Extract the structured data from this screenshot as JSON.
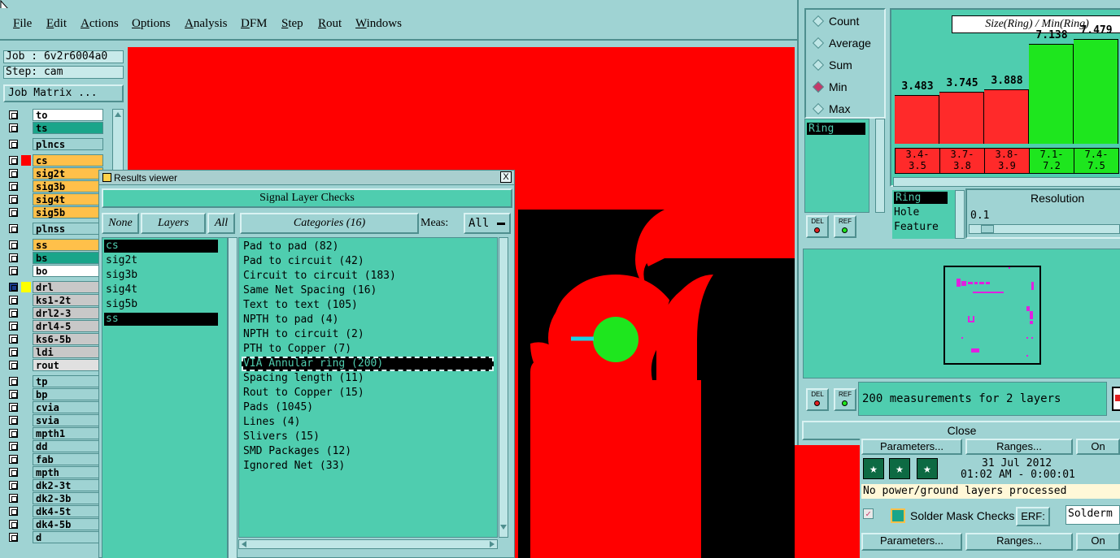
{
  "menu": [
    "File",
    "Edit",
    "Actions",
    "Options",
    "Analysis",
    "DFM",
    "Step",
    "Rout",
    "Windows"
  ],
  "job": {
    "job_label": "Job : 6v2r6004a0",
    "step_label": "Step: cam",
    "matrix_button": "Job Matrix ..."
  },
  "layers": [
    {
      "name": "to",
      "color": "#ffffff",
      "mark": ""
    },
    {
      "name": "ts",
      "color": "#1aa58a",
      "mark": ""
    },
    {
      "name": "plncs",
      "color": "#9fd3d3",
      "mark": ""
    },
    {
      "name": "cs",
      "color": "#ffc04a",
      "mark": "#ff0000"
    },
    {
      "name": "sig2t",
      "color": "#ffc04a",
      "mark": ""
    },
    {
      "name": "sig3b",
      "color": "#ffc04a",
      "mark": ""
    },
    {
      "name": "sig4t",
      "color": "#ffc04a",
      "mark": ""
    },
    {
      "name": "sig5b",
      "color": "#ffc04a",
      "mark": ""
    },
    {
      "name": "plnss",
      "color": "#9fd3d3",
      "mark": ""
    },
    {
      "name": "ss",
      "color": "#ffc04a",
      "mark": ""
    },
    {
      "name": "bs",
      "color": "#1aa58a",
      "mark": ""
    },
    {
      "name": "bo",
      "color": "#ffffff",
      "mark": ""
    },
    {
      "name": "drl",
      "color": "#c8c8c8",
      "mark": "#ffff00"
    },
    {
      "name": "ks1-2t",
      "color": "#c8c8c8",
      "mark": ""
    },
    {
      "name": "drl2-3",
      "color": "#c8c8c8",
      "mark": ""
    },
    {
      "name": "drl4-5",
      "color": "#c8c8c8",
      "mark": ""
    },
    {
      "name": "ks6-5b",
      "color": "#c8c8c8",
      "mark": ""
    },
    {
      "name": "ldi",
      "color": "#c8c8c8",
      "mark": ""
    },
    {
      "name": "rout",
      "color": "#e0e0e0",
      "mark": ""
    },
    {
      "name": "tp",
      "color": "#9fd3d3",
      "mark": ""
    },
    {
      "name": "bp",
      "color": "#9fd3d3",
      "mark": ""
    },
    {
      "name": "cvia",
      "color": "#9fd3d3",
      "mark": ""
    },
    {
      "name": "svia",
      "color": "#9fd3d3",
      "mark": ""
    },
    {
      "name": "mpth1",
      "color": "#9fd3d3",
      "mark": ""
    },
    {
      "name": "dd",
      "color": "#9fd3d3",
      "mark": ""
    },
    {
      "name": "fab",
      "color": "#9fd3d3",
      "mark": ""
    },
    {
      "name": "mpth",
      "color": "#9fd3d3",
      "mark": ""
    },
    {
      "name": "dk2-3t",
      "color": "#9fd3d3",
      "mark": ""
    },
    {
      "name": "dk2-3b",
      "color": "#9fd3d3",
      "mark": ""
    },
    {
      "name": "dk4-5t",
      "color": "#9fd3d3",
      "mark": ""
    },
    {
      "name": "dk4-5b",
      "color": "#9fd3d3",
      "mark": ""
    },
    {
      "name": "d",
      "color": "#9fd3d3",
      "mark": ""
    }
  ],
  "results_viewer": {
    "title": "Results viewer",
    "close": "X",
    "header": "Signal Layer Checks",
    "none_btn": "None",
    "layers_btn": "Layers",
    "all_btn": "All",
    "categories_btn": "Categories (16)",
    "meas_label": "Meas:",
    "meas_value": "All",
    "layer_items": [
      "cs",
      "sig2t",
      "sig3b",
      "sig4t",
      "sig5b",
      "ss"
    ],
    "categories": [
      "Pad to pad (82)",
      "Pad to circuit (42)",
      "Circuit to circuit (183)",
      "Same Net Spacing (16)",
      "Text to text (105)",
      "NPTH to pad (4)",
      "NPTH to circuit (2)",
      "PTH to Copper (7)",
      "VIA Annular ring (200)",
      "Spacing length (11)",
      "Rout to Copper (15)",
      "Pads (1045)",
      "Lines (4)",
      "Slivers (15)",
      "SMD Packages (12)",
      "Ignored Net (33)"
    ],
    "selected_category": "VIA Annular ring (200)"
  },
  "histogram": {
    "radios": [
      "Count",
      "Average",
      "Sum",
      "Min",
      "Max"
    ],
    "selected_radio": "Min",
    "list1": [
      "Ring"
    ],
    "title": "Size(Ring) / Min(Ring)",
    "resolution_label": "Resolution",
    "resolution_value": "0.1",
    "list2": [
      "Ring",
      "Hole",
      "Feature"
    ],
    "del_label": "DEL",
    "ref_label": "REF",
    "message": "200 measurements for 2 layers",
    "close_label": "Close"
  },
  "chart_data": {
    "type": "bar",
    "title": "Size(Ring) / Min(Ring)",
    "categories": [
      "3.4-3.5",
      "3.7-3.8",
      "3.8-3.9",
      "7.1-7.2",
      "7.4-7.5"
    ],
    "values": [
      3.483,
      3.745,
      3.888,
      7.138,
      7.479
    ],
    "value_labels": [
      "3.483",
      "3.745",
      "3.888",
      "7.138",
      "7.479"
    ],
    "bin_labels_top": [
      "3.4-",
      "3.7-",
      "3.8-",
      "7.1-",
      "7.4-"
    ],
    "bin_labels_bottom": [
      "3.5",
      "3.8",
      "3.9",
      "7.2",
      "7.5"
    ],
    "colors": [
      "#ff2a2a",
      "#ff2a2a",
      "#ff2a2a",
      "#1ee61e",
      "#1ee61e"
    ],
    "ylim": [
      0,
      8
    ]
  },
  "lower_right": {
    "parameters": "Parameters...",
    "ranges": "Ranges...",
    "on": "On",
    "date": "31 Jul 2012",
    "time": "01:02 AM - 0:00:01",
    "status": "No power/ground layers processed",
    "check_name": "Solder Mask Checks",
    "erf_label": "ERF:",
    "erf_value": "Solderm",
    "parameters2": "Parameters...",
    "ranges2": "Ranges...",
    "on2": "On"
  }
}
